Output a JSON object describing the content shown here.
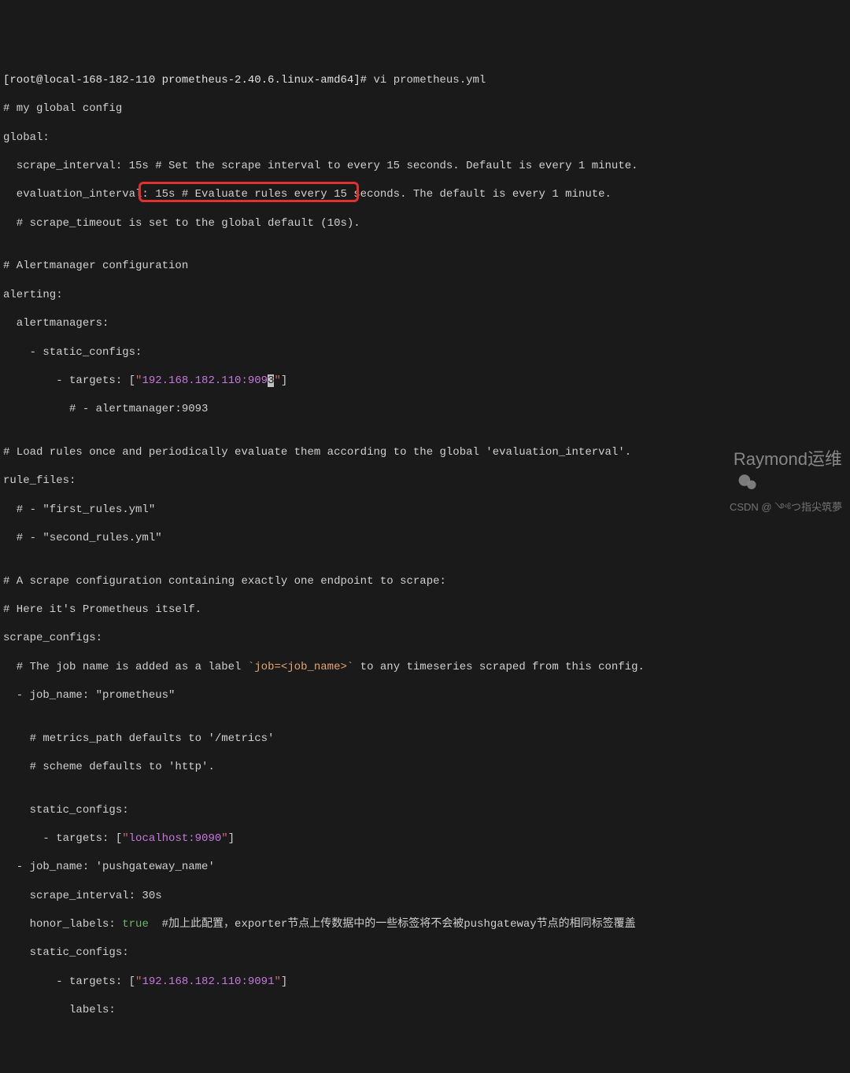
{
  "terminal": {
    "prompt": "[root@local-168-182-110 prometheus-2.40.6.linux-amd64]# ",
    "command": "vi prometheus.yml",
    "lines": [
      {
        "t": "# my global config"
      },
      {
        "t": "global:"
      },
      {
        "t": "  scrape_interval: 15s # Set the scrape interval to every 15 seconds. Default is every 1 minute."
      },
      {
        "t": "  evaluation_interval: 15s # Evaluate rules every 15 seconds. The default is every 1 minute."
      },
      {
        "t": "  # scrape_timeout is set to the global default (10s)."
      },
      {
        "t": ""
      },
      {
        "t": "# Alertmanager configuration"
      },
      {
        "t": "alerting:"
      },
      {
        "t": "  alertmanagers:"
      },
      {
        "t": "    - static_configs:"
      }
    ],
    "target_line": {
      "prefix": "        - targets: [",
      "quote_open": "\"",
      "ip": "192.168.182.110:909",
      "cursor_char": "3",
      "quote_close": "\"",
      "suffix": "]"
    },
    "lines2": [
      {
        "t": "          # - alertmanager:9093"
      },
      {
        "t": ""
      },
      {
        "t": "# Load rules once and periodically evaluate them according to the global 'evaluation_interval'."
      },
      {
        "t": "rule_files:"
      },
      {
        "t": "  # - \"first_rules.yml\""
      },
      {
        "t": "  # - \"second_rules.yml\""
      },
      {
        "t": ""
      },
      {
        "t": "# A scrape configuration containing exactly one endpoint to scrape:"
      },
      {
        "t": "# Here it's Prometheus itself."
      },
      {
        "t": "scrape_configs:"
      }
    ],
    "job_label_line": {
      "prefix": "  # The job name is added as a label ",
      "code": "`job=<job_name>`",
      "suffix": " to any timeseries scraped from this config."
    },
    "lines3": [
      {
        "t": "  - job_name: \"prometheus\""
      },
      {
        "t": ""
      },
      {
        "t": "    # metrics_path defaults to '/metrics'"
      },
      {
        "t": "    # scheme defaults to 'http'."
      },
      {
        "t": ""
      },
      {
        "t": "    static_configs:"
      }
    ],
    "localhost_line": {
      "prefix": "      - targets: [",
      "quote_open": "\"",
      "host": "localhost:9090",
      "quote_close": "\"",
      "suffix": "]"
    },
    "lines4": [
      {
        "t": "  - job_name: 'pushgateway_name'"
      },
      {
        "t": "    scrape_interval: 30s"
      }
    ],
    "honor_line": {
      "prefix": "    honor_labels: ",
      "true_kw": "true",
      "comment": "  #加上此配置，exporter节点上传数据中的一些标签将不会被pushgateway节点的相同标签覆盖"
    },
    "lines5": [
      {
        "t": "    static_configs:"
      }
    ],
    "push_target_line": {
      "prefix": "        - targets: [",
      "quote_open": "\"",
      "ip": "192.168.182.110:9091",
      "quote_close": "\"",
      "suffix": "]"
    },
    "lines6": [
      {
        "t": "          labels:"
      }
    ]
  },
  "watermark": {
    "brand": "Raymond运维",
    "csdn": "CSDN @ ༺つ指尖筑夢"
  }
}
